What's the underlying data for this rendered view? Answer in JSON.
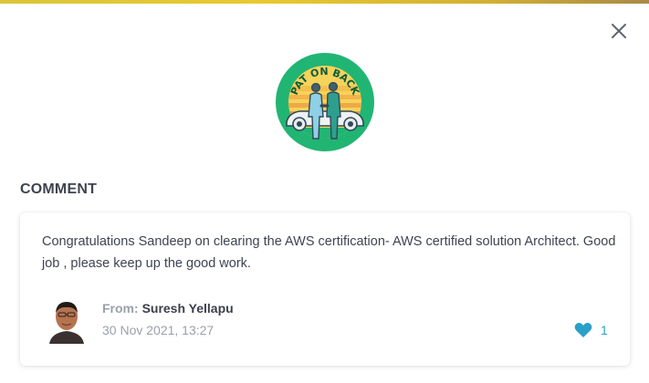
{
  "badge": {
    "text": "PAT ON BACK",
    "icon": "pat-on-back-badge-icon"
  },
  "section": {
    "title": "COMMENT"
  },
  "comment": {
    "text": "Congratulations Sandeep on clearing the AWS certification- AWS certified solution Architect. Good job , please keep up the good work.",
    "from_label": "From:",
    "author": "Suresh Yellapu",
    "timestamp": "30 Nov 2021, 13:27",
    "likes": "1"
  },
  "colors": {
    "accent_bar": "#d9c53a",
    "badge_green": "#21b573",
    "like_blue": "#2aa0c8",
    "text_dark": "#3d4351",
    "text_muted": "#9aa0ab"
  },
  "icons": {
    "close": "close-icon",
    "like": "heart-icon",
    "avatar": "avatar"
  }
}
